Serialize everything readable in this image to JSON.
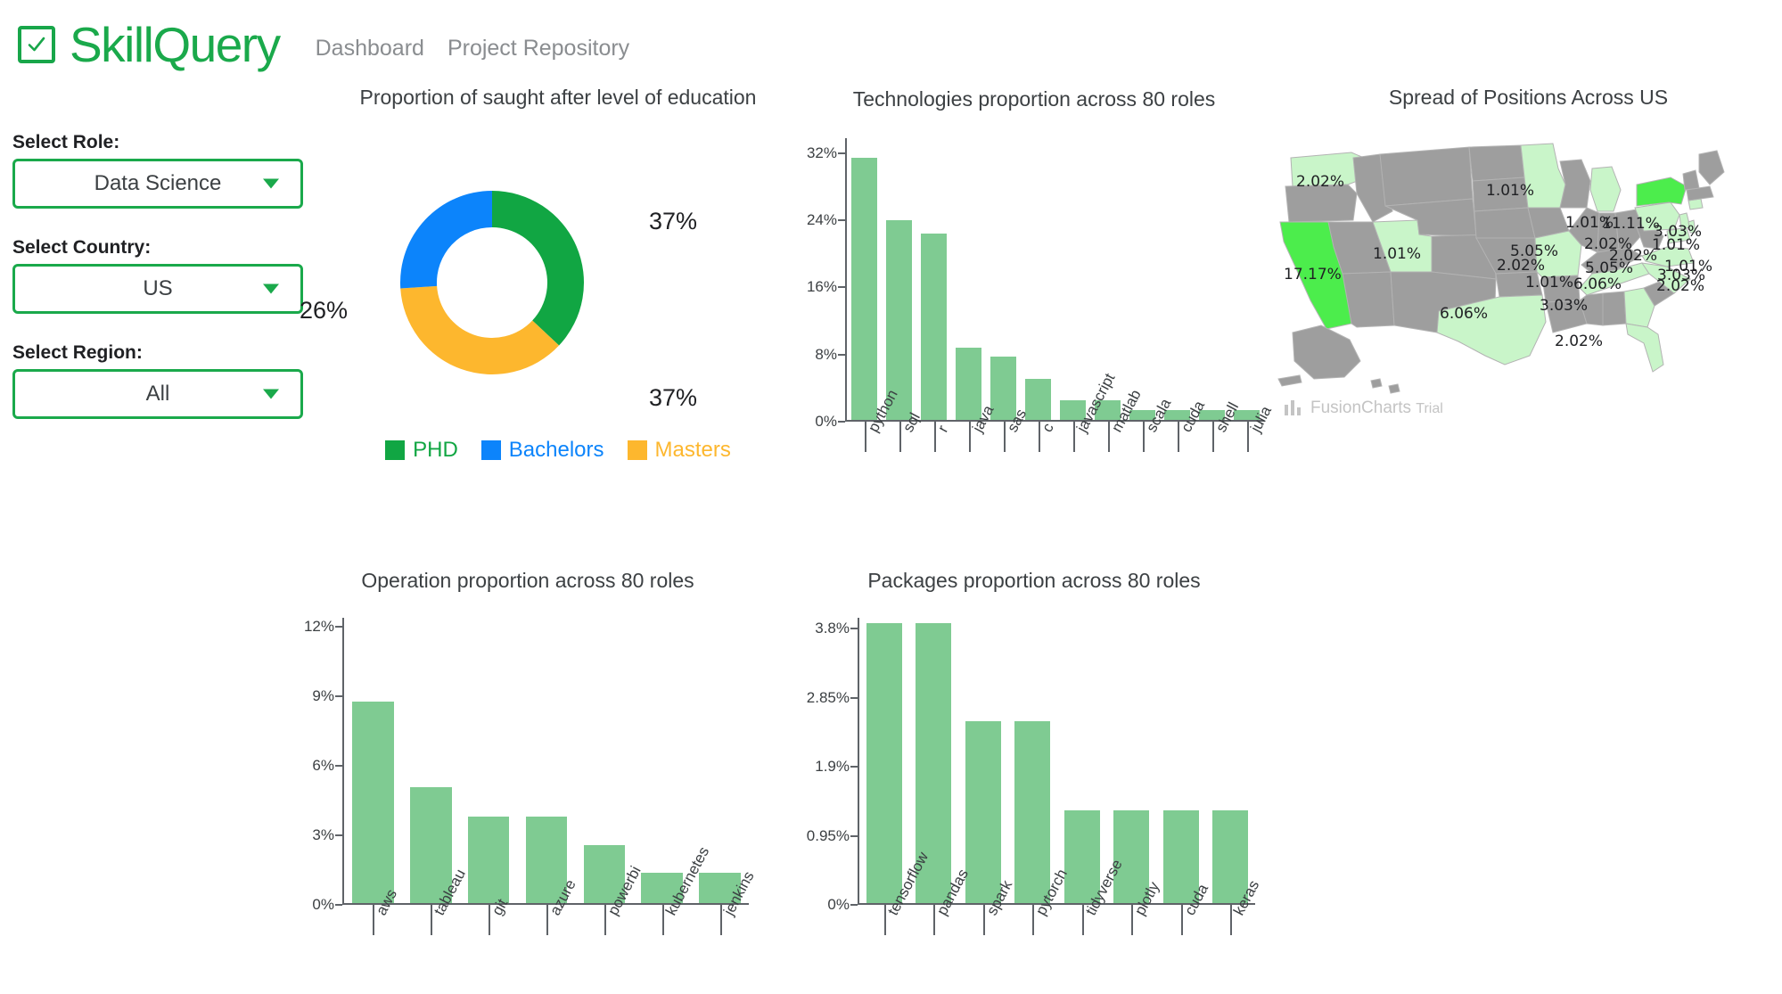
{
  "app": {
    "brand_name": "SkillQuery",
    "brand_icon": "checkbox-check-icon",
    "brand_color": "#1aa94b"
  },
  "nav": {
    "items": [
      {
        "label": "Dashboard"
      },
      {
        "label": "Project Repository"
      }
    ]
  },
  "sidebar": {
    "filters": [
      {
        "label": "Select Role:",
        "value": "Data Science"
      },
      {
        "label": "Select Country:",
        "value": "US"
      },
      {
        "label": "Select Region:",
        "value": "All"
      }
    ]
  },
  "chart_data": [
    {
      "type": "pie",
      "id": "education-donut",
      "title": "Proportion of saught after level of education",
      "slices": [
        {
          "label": "PHD",
          "value": 37,
          "display": "37%",
          "color": "#11a643"
        },
        {
          "label": "Masters",
          "value": 37,
          "display": "37%",
          "color": "#fdb72e"
        },
        {
          "label": "Bachelors",
          "value": 26,
          "display": "26%",
          "color": "#0c84fb"
        }
      ],
      "legend": [
        {
          "label": "PHD",
          "color": "#11a643"
        },
        {
          "label": "Bachelors",
          "color": "#0c84fb"
        },
        {
          "label": "Masters",
          "color": "#fdb72e"
        }
      ],
      "legend_position": "bottom"
    },
    {
      "type": "bar",
      "id": "technologies-bar",
      "title": "Technologies proportion across 80 roles",
      "categories": [
        "python",
        "sql",
        "r",
        "java",
        "sas",
        "c",
        "javascript",
        "matlab",
        "scala",
        "cuda",
        "shell",
        "julia"
      ],
      "values": [
        31.3,
        23.8,
        22.2,
        8.6,
        7.5,
        4.9,
        2.3,
        2.3,
        1.2,
        1.2,
        1.2,
        1.2
      ],
      "ytick_labels": [
        "0%",
        "8%",
        "16%",
        "24%",
        "32%"
      ],
      "ytick_values": [
        0,
        8,
        16,
        24,
        32
      ],
      "ylim": [
        0,
        33.8
      ],
      "xlabel": "",
      "ylabel": "",
      "grid": false,
      "bar_color": "#7fcb92"
    },
    {
      "type": "bar",
      "id": "operation-bar",
      "title": "Operation proportion across 80 roles",
      "categories": [
        "aws",
        "tableau",
        "git",
        "azure",
        "powerbi",
        "kubernetes",
        "jenkins"
      ],
      "values": [
        8.7,
        5.0,
        3.75,
        3.75,
        2.5,
        1.3,
        1.3
      ],
      "ytick_labels": [
        "0%",
        "3%",
        "6%",
        "9%",
        "12%"
      ],
      "ytick_values": [
        0,
        3,
        6,
        9,
        12
      ],
      "ylim": [
        0,
        12.4
      ],
      "xlabel": "",
      "ylabel": "",
      "grid": false,
      "bar_color": "#7fcb92"
    },
    {
      "type": "bar",
      "id": "packages-bar",
      "title": "Packages proportion across 80 roles",
      "categories": [
        "tensorflow",
        "pandas",
        "spark",
        "pytorch",
        "tidyverse",
        "plotly",
        "cuda",
        "keras"
      ],
      "values": [
        3.85,
        3.85,
        2.5,
        2.5,
        1.27,
        1.27,
        1.27,
        1.27
      ],
      "ytick_labels": [
        "0%",
        "0.95%",
        "1.9%",
        "2.85%",
        "3.8%"
      ],
      "ytick_values": [
        0,
        0.95,
        1.9,
        2.85,
        3.8
      ],
      "ylim": [
        0,
        3.95
      ],
      "xlabel": "",
      "ylabel": "",
      "grid": false,
      "bar_color": "#7fcb92"
    },
    {
      "type": "heatmap",
      "id": "us-map",
      "title": "Spread of Positions Across US",
      "map_labels": [
        {
          "text": "2.02%",
          "x": 24,
          "y": 57
        },
        {
          "text": "1.01%",
          "x": 237,
          "y": 67
        },
        {
          "text": "1.01%",
          "x": 326,
          "y": 103
        },
        {
          "text": "11.11%",
          "x": 367,
          "y": 104
        },
        {
          "text": "3.03%",
          "x": 425,
          "y": 113
        },
        {
          "text": "1.01%",
          "x": 423,
          "y": 128
        },
        {
          "text": "2.02%",
          "x": 347,
          "y": 127
        },
        {
          "text": "2.02%",
          "x": 375,
          "y": 140
        },
        {
          "text": "1.01%",
          "x": 110,
          "y": 138
        },
        {
          "text": "5.05%",
          "x": 264,
          "y": 135
        },
        {
          "text": "2.02%",
          "x": 249,
          "y": 151
        },
        {
          "text": "17.17%",
          "x": 10,
          "y": 161
        },
        {
          "text": "5.05%",
          "x": 348,
          "y": 154
        },
        {
          "text": "1.01%",
          "x": 437,
          "y": 152
        },
        {
          "text": "3.03%",
          "x": 429,
          "y": 162
        },
        {
          "text": "2.02%",
          "x": 428,
          "y": 174
        },
        {
          "text": "1.01%",
          "x": 281,
          "y": 170
        },
        {
          "text": "6.06%",
          "x": 335,
          "y": 172
        },
        {
          "text": "3.03%",
          "x": 297,
          "y": 196
        },
        {
          "text": "6.06%",
          "x": 185,
          "y": 205
        },
        {
          "text": "2.02%",
          "x": 314,
          "y": 236
        }
      ],
      "colors": {
        "inactive": "#9e9e9e",
        "low": "#c9f5c9",
        "mid": "#8ff18f",
        "high": "#4ced4c"
      },
      "watermark": {
        "brand": "FusionCharts",
        "suffix": "Trial"
      }
    }
  ]
}
